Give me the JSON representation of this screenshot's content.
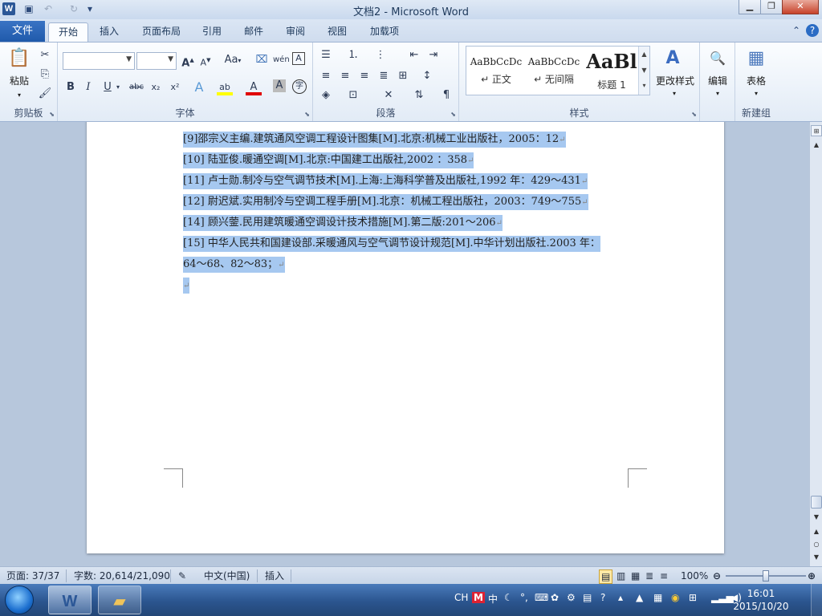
{
  "window": {
    "title": "文档2 - Microsoft Word",
    "app_icon": "W",
    "buttons": {
      "minimize": "▁",
      "maximize": "❐",
      "close": "✕"
    }
  },
  "quick_access": {
    "save_icon": "▣",
    "undo_icon": "↶",
    "redo_icon": "↻",
    "customize_icon": "▾"
  },
  "tabs": [
    {
      "label": "文件"
    },
    {
      "label": "开始"
    },
    {
      "label": "插入"
    },
    {
      "label": "页面布局"
    },
    {
      "label": "引用"
    },
    {
      "label": "邮件"
    },
    {
      "label": "审阅"
    },
    {
      "label": "视图"
    },
    {
      "label": "加载项"
    }
  ],
  "ribbon": {
    "clipboard": {
      "label": "剪贴板",
      "paste": "粘贴"
    },
    "font": {
      "label": "字体",
      "font_name": "",
      "font_size": "",
      "bold": "B",
      "italic": "I",
      "underline": "U",
      "strike": "abc",
      "subscript": "x₂",
      "superscript": "x²",
      "grow": "A",
      "shrink": "A",
      "change_case": "Aa",
      "text_effects": "A",
      "highlight": "ab",
      "font_color": "A",
      "char_shading": "A",
      "enclose": "字"
    },
    "paragraph": {
      "label": "段落"
    },
    "styles": {
      "label": "样式",
      "items": [
        {
          "sample": "AaBbCcDc",
          "name": "↵ 正文"
        },
        {
          "sample": "AaBbCcDc",
          "name": "↵ 无间隔"
        },
        {
          "sample": "AaBl",
          "name": "标题 1"
        }
      ],
      "change_styles": "更改样式"
    },
    "editing": {
      "label": "编辑"
    },
    "new_group": {
      "label": "新建组",
      "table": "表格"
    }
  },
  "document": {
    "references": [
      "[9]邵宗义主编.建筑通风空调工程设计图集[M].北京:机械工业出版社，2005：12",
      "[10]  陆亚俊.暖通空调[M].北京:中国建工出版社,2002 ：358",
      "[11]  卢士勋.制冷与空气调节技术[M].上海:上海科学普及出版社,1992 年：429～431",
      "[12]  尉迟斌.实用制冷与空调工程手册[M].北京：机械工程出版社，2003：749～755",
      "[14]  顾兴蓥.民用建筑暖通空调设计技术措施[M].第二版:201～206",
      "[15]   中华人民共和国建设部.采暖通风与空气调节设计规范[M].中华计划出版社.2003  年：",
      "64～68、82～83；"
    ],
    "paragraph_mark": "↵",
    "highlight_color": "#a6c8f0"
  },
  "statusbar": {
    "page": "页面: 37/37",
    "words": "字数: 20,614/21,090",
    "language": "中文(中国)",
    "mode": "插入",
    "zoom": "100%"
  },
  "taskbar": {
    "tray": {
      "ime": "CH",
      "chinese": "中"
    },
    "clock": {
      "time": "16:01",
      "date": "2015/10/20"
    }
  }
}
